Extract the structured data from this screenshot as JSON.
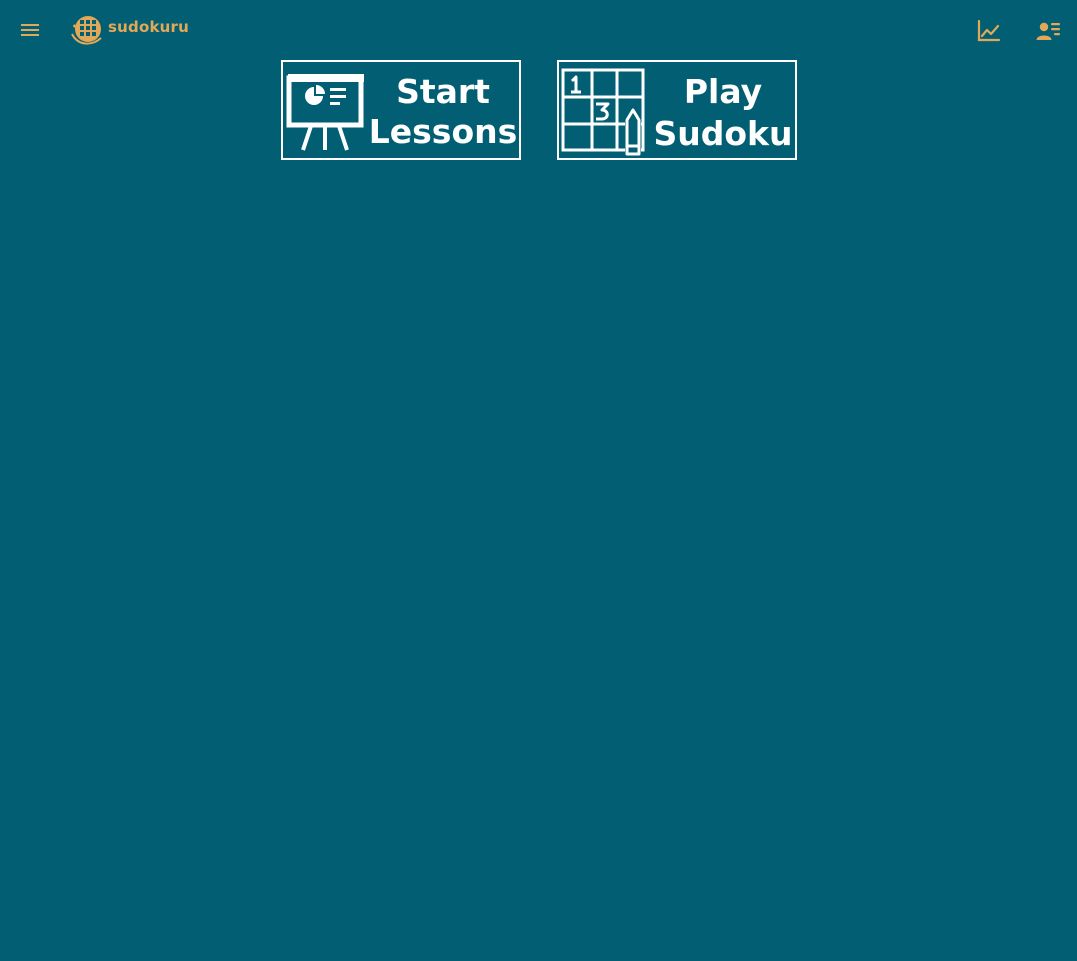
{
  "app": {
    "name": "sudokuru",
    "accent_color": "#e3a857",
    "background_color": "#025f73"
  },
  "header": {
    "menu_icon": "hamburger-menu-icon",
    "stats_icon": "line-chart-icon",
    "profile_icon": "user-list-icon"
  },
  "tiles": {
    "lessons": {
      "line1": "Start",
      "line2": "Lessons",
      "icon": "presentation-board-icon"
    },
    "play": {
      "line1": "Play",
      "line2": "Sudoku",
      "icon": "sudoku-grid-pencil-icon"
    }
  }
}
